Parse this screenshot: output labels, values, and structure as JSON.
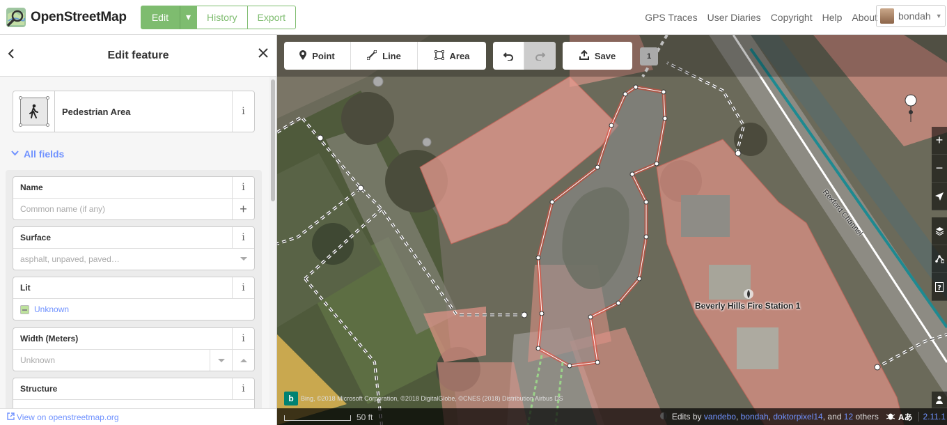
{
  "nav": {
    "brand": "OpenStreetMap",
    "edit": "Edit",
    "history": "History",
    "export": "Export",
    "links": [
      "GPS Traces",
      "User Diaries",
      "Copyright",
      "Help",
      "About"
    ],
    "username": "bondah"
  },
  "sidebar": {
    "title": "Edit feature",
    "preset_name": "Pedestrian Area",
    "all_fields": "All fields",
    "fields": {
      "name": {
        "label": "Name",
        "placeholder": "Common name (if any)"
      },
      "surface": {
        "label": "Surface",
        "placeholder": "asphalt, unpaved, paved…"
      },
      "lit": {
        "label": "Lit",
        "value": "Unknown"
      },
      "width": {
        "label": "Width (Meters)",
        "placeholder": "Unknown"
      },
      "structure": {
        "label": "Structure"
      }
    },
    "footer_link": "View on openstreetmap.org"
  },
  "map": {
    "tools": {
      "point": "Point",
      "line": "Line",
      "area": "Area",
      "save": "Save"
    },
    "edit_count": "1",
    "label_fire_station": "Beverly Hills Fire Station 1",
    "label_channel": "Rexford Channel",
    "attribution": "Bing, ©2018 Microsoft Corporation, ©2018 DigitalGlobe, ©CNES (2018) Distribution Airbus DS",
    "scale_label": "50 ft",
    "edits_by_prefix": "Edits by",
    "editors": [
      "vandebo",
      "bondah",
      "doktorpixel14"
    ],
    "others_prefix": ", and",
    "others_count": "12",
    "others_suffix": "others",
    "version": "2.11.1"
  },
  "colors": {
    "osm_green": "#7ebc6f",
    "link_blue": "#7092ff",
    "selected_area": "#e06e5f",
    "building_fill": "#e06e5f"
  }
}
